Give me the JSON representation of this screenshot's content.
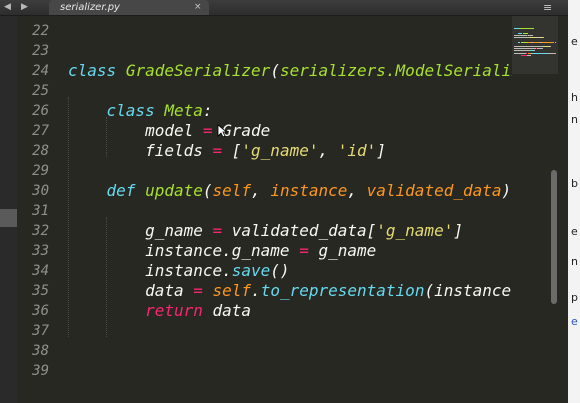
{
  "tab": {
    "filename": "serializer.py",
    "close_glyph": "×"
  },
  "nav": {
    "back": "◀",
    "forward": "▶"
  },
  "menu_glyph": "≡",
  "lines": [
    {
      "number": "22",
      "tokens": []
    },
    {
      "number": "23",
      "tokens": []
    },
    {
      "number": "24",
      "tokens": [
        {
          "t": "class",
          "c": "kw"
        },
        {
          "t": " ",
          "c": ""
        },
        {
          "t": "GradeSerializer",
          "c": "cls"
        },
        {
          "t": "(",
          "c": ""
        },
        {
          "t": "serializers.ModelSerializer",
          "c": "cls"
        },
        {
          "t": "):",
          "c": ""
        }
      ]
    },
    {
      "number": "25",
      "tokens": []
    },
    {
      "number": "26",
      "tokens": [
        {
          "t": "    ",
          "c": ""
        },
        {
          "t": "class",
          "c": "kw"
        },
        {
          "t": " ",
          "c": ""
        },
        {
          "t": "Meta",
          "c": "cls"
        },
        {
          "t": ":",
          "c": ""
        }
      ]
    },
    {
      "number": "27",
      "tokens": [
        {
          "t": "        model ",
          "c": ""
        },
        {
          "t": "=",
          "c": "op"
        },
        {
          "t": " Grade",
          "c": ""
        }
      ]
    },
    {
      "number": "28",
      "tokens": [
        {
          "t": "        fields ",
          "c": ""
        },
        {
          "t": "=",
          "c": "op"
        },
        {
          "t": " [",
          "c": ""
        },
        {
          "t": "'g_name'",
          "c": "str"
        },
        {
          "t": ", ",
          "c": ""
        },
        {
          "t": "'id'",
          "c": "str"
        },
        {
          "t": "]",
          "c": ""
        }
      ]
    },
    {
      "number": "29",
      "tokens": []
    },
    {
      "number": "30",
      "tokens": [
        {
          "t": "    ",
          "c": ""
        },
        {
          "t": "def",
          "c": "kw"
        },
        {
          "t": " ",
          "c": ""
        },
        {
          "t": "update",
          "c": "fn"
        },
        {
          "t": "(",
          "c": ""
        },
        {
          "t": "self",
          "c": "param"
        },
        {
          "t": ", ",
          "c": ""
        },
        {
          "t": "instance",
          "c": "param"
        },
        {
          "t": ", ",
          "c": ""
        },
        {
          "t": "validated_data",
          "c": "param"
        },
        {
          "t": "):",
          "c": ""
        }
      ]
    },
    {
      "number": "31",
      "tokens": []
    },
    {
      "number": "32",
      "tokens": [
        {
          "t": "        g_name ",
          "c": ""
        },
        {
          "t": "=",
          "c": "op"
        },
        {
          "t": " validated_data[",
          "c": ""
        },
        {
          "t": "'g_name'",
          "c": "str"
        },
        {
          "t": "]",
          "c": ""
        }
      ]
    },
    {
      "number": "33",
      "tokens": [
        {
          "t": "        instance.g_name ",
          "c": ""
        },
        {
          "t": "=",
          "c": "op"
        },
        {
          "t": " g_name",
          "c": ""
        }
      ]
    },
    {
      "number": "34",
      "tokens": [
        {
          "t": "        instance.",
          "c": ""
        },
        {
          "t": "save",
          "c": "kw"
        },
        {
          "t": "()",
          "c": ""
        }
      ]
    },
    {
      "number": "35",
      "tokens": [
        {
          "t": "        data ",
          "c": ""
        },
        {
          "t": "=",
          "c": "op"
        },
        {
          "t": " ",
          "c": ""
        },
        {
          "t": "self",
          "c": "selfkw"
        },
        {
          "t": ".",
          "c": ""
        },
        {
          "t": "to_representation",
          "c": "kw"
        },
        {
          "t": "(instance)",
          "c": ""
        }
      ]
    },
    {
      "number": "36",
      "tokens": [
        {
          "t": "        ",
          "c": ""
        },
        {
          "t": "return",
          "c": "op"
        },
        {
          "t": " data",
          "c": ""
        }
      ]
    },
    {
      "number": "37",
      "tokens": []
    },
    {
      "number": "38",
      "tokens": []
    },
    {
      "number": "39",
      "tokens": []
    }
  ],
  "right_window_chars": [
    {
      "t": "e",
      "blue": false
    },
    {
      "t": "h",
      "blue": false
    },
    {
      "t": "n",
      "blue": false
    },
    {
      "t": "b",
      "blue": false
    },
    {
      "t": "e",
      "blue": false
    },
    {
      "t": "n",
      "blue": false
    },
    {
      "t": "p",
      "blue": false
    },
    {
      "t": "e",
      "blue": true
    }
  ],
  "colors": {
    "background": "#272822",
    "keyword": "#66d9ef",
    "class_name": "#a6e22e",
    "operator": "#f92672",
    "string": "#e6db74",
    "parameter": "#fd971f"
  }
}
